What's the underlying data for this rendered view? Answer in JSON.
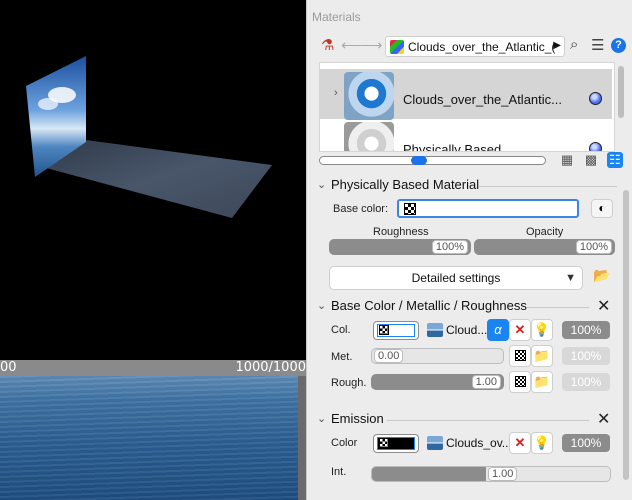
{
  "viewport": {
    "timeline_left": "00",
    "timeline_right": "1000/1000"
  },
  "panel": {
    "title": "Materials",
    "path_value": "Clouds_over_the_Atlantic_("
  },
  "material_list": [
    {
      "name": "Clouds_over_the_Atlantic...",
      "selected": true
    },
    {
      "name": "Physically Based",
      "selected": false
    }
  ],
  "pbm": {
    "header": "Physically Based Material",
    "base_color_label": "Base color:",
    "roughness_label": "Roughness",
    "roughness_value": "100%",
    "opacity_label": "Opacity",
    "opacity_value": "100%",
    "detailed_settings": "Detailed settings"
  },
  "bcmr": {
    "header": "Base Color /  Metallic / Roughness",
    "col_label": "Col.",
    "col_texture": "Cloud...",
    "col_alpha": "α",
    "col_pct": "100%",
    "met_label": "Met.",
    "met_value": "0.00",
    "met_pct": "100%",
    "rough_label": "Rough.",
    "rough_value": "1.00",
    "rough_pct": "100%"
  },
  "emission": {
    "header": "Emission",
    "color_label": "Color",
    "color_texture": "Clouds_ov...",
    "color_pct": "100%",
    "int_label": "Int.",
    "int_value": "1.00"
  },
  "colors": {
    "accent": "#1a84f0",
    "panel_bg": "#ececec"
  },
  "icons": [
    "material-add-icon",
    "back-arrow-icon",
    "forward-arrow-icon",
    "search-icon",
    "menu-icon",
    "help-icon",
    "close-icon",
    "folder-icon",
    "checker-icon",
    "bulb-icon",
    "delete-icon"
  ]
}
